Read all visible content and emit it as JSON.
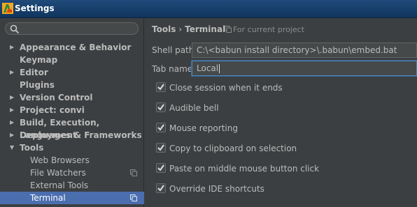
{
  "window": {
    "title": "Settings",
    "icon": "app-logo-icon"
  },
  "search": {
    "placeholder": ""
  },
  "sidebar": {
    "items": [
      {
        "label": "Appearance & Behavior",
        "expandable": true
      },
      {
        "label": "Keymap",
        "expandable": false
      },
      {
        "label": "Editor",
        "expandable": true
      },
      {
        "label": "Plugins",
        "expandable": false
      },
      {
        "label": "Version Control",
        "expandable": true
      },
      {
        "label": "Project: convi",
        "expandable": true
      },
      {
        "label": "Build, Execution, Deployment",
        "expandable": true
      },
      {
        "label": "Languages & Frameworks",
        "expandable": true
      },
      {
        "label": "Tools",
        "expandable": true,
        "expanded": true
      }
    ],
    "tools_children": [
      {
        "label": "Web Browsers",
        "project_scoped": false
      },
      {
        "label": "File Watchers",
        "project_scoped": true
      },
      {
        "label": "External Tools",
        "project_scoped": false
      },
      {
        "label": "Terminal",
        "project_scoped": true,
        "selected": true
      }
    ]
  },
  "breadcrumb": {
    "parent": "Tools",
    "separator": "›",
    "current": "Terminal",
    "scope": "For current project"
  },
  "fields": {
    "shell_path": {
      "label": "Shell path",
      "value": "C:\\<babun install directory>\\.babun\\embed.bat"
    },
    "tab_name": {
      "label": "Tab name",
      "value": "Local"
    }
  },
  "options": [
    {
      "label": "Close session when it ends",
      "checked": true
    },
    {
      "label": "Audible bell",
      "checked": true
    },
    {
      "label": "Mouse reporting",
      "checked": true
    },
    {
      "label": "Copy to clipboard on selection",
      "checked": true
    },
    {
      "label": "Paste on middle mouse button click",
      "checked": true
    },
    {
      "label": "Override IDE shortcuts",
      "checked": true
    }
  ],
  "colors": {
    "selection": "#4b6eaf",
    "background": "#3c3f41",
    "focus_border": "#4a88c7",
    "titlebar": "#1f4a7a"
  }
}
